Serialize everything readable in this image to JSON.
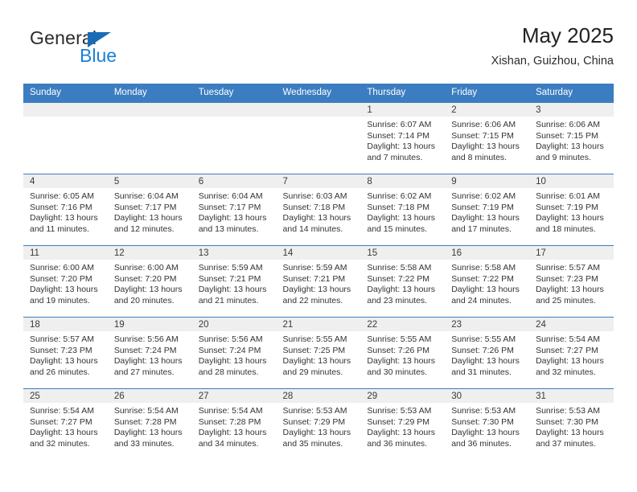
{
  "brand": {
    "name_top": "General",
    "name_bottom": "Blue",
    "triangle_color": "#1a6cb5",
    "blue_color": "#1a7fd4"
  },
  "header": {
    "title": "May 2025",
    "subtitle": "Xishan, Guizhou, China"
  },
  "theme": {
    "header_bg": "#3b7dc0",
    "date_band_bg": "#efefef",
    "row_rule": "#3b7dc0"
  },
  "weekday_headers": [
    "Sunday",
    "Monday",
    "Tuesday",
    "Wednesday",
    "Thursday",
    "Friday",
    "Saturday"
  ],
  "weeks": [
    [
      {
        "day": "",
        "empty": true,
        "sunrise": "",
        "sunset": "",
        "daylight_1": "",
        "daylight_2": ""
      },
      {
        "day": "",
        "empty": true,
        "sunrise": "",
        "sunset": "",
        "daylight_1": "",
        "daylight_2": ""
      },
      {
        "day": "",
        "empty": true,
        "sunrise": "",
        "sunset": "",
        "daylight_1": "",
        "daylight_2": ""
      },
      {
        "day": "",
        "empty": true,
        "sunrise": "",
        "sunset": "",
        "daylight_1": "",
        "daylight_2": ""
      },
      {
        "day": "1",
        "empty": false,
        "sunrise": "Sunrise: 6:07 AM",
        "sunset": "Sunset: 7:14 PM",
        "daylight_1": "Daylight: 13 hours",
        "daylight_2": "and 7 minutes."
      },
      {
        "day": "2",
        "empty": false,
        "sunrise": "Sunrise: 6:06 AM",
        "sunset": "Sunset: 7:15 PM",
        "daylight_1": "Daylight: 13 hours",
        "daylight_2": "and 8 minutes."
      },
      {
        "day": "3",
        "empty": false,
        "sunrise": "Sunrise: 6:06 AM",
        "sunset": "Sunset: 7:15 PM",
        "daylight_1": "Daylight: 13 hours",
        "daylight_2": "and 9 minutes."
      }
    ],
    [
      {
        "day": "4",
        "empty": false,
        "sunrise": "Sunrise: 6:05 AM",
        "sunset": "Sunset: 7:16 PM",
        "daylight_1": "Daylight: 13 hours",
        "daylight_2": "and 11 minutes."
      },
      {
        "day": "5",
        "empty": false,
        "sunrise": "Sunrise: 6:04 AM",
        "sunset": "Sunset: 7:17 PM",
        "daylight_1": "Daylight: 13 hours",
        "daylight_2": "and 12 minutes."
      },
      {
        "day": "6",
        "empty": false,
        "sunrise": "Sunrise: 6:04 AM",
        "sunset": "Sunset: 7:17 PM",
        "daylight_1": "Daylight: 13 hours",
        "daylight_2": "and 13 minutes."
      },
      {
        "day": "7",
        "empty": false,
        "sunrise": "Sunrise: 6:03 AM",
        "sunset": "Sunset: 7:18 PM",
        "daylight_1": "Daylight: 13 hours",
        "daylight_2": "and 14 minutes."
      },
      {
        "day": "8",
        "empty": false,
        "sunrise": "Sunrise: 6:02 AM",
        "sunset": "Sunset: 7:18 PM",
        "daylight_1": "Daylight: 13 hours",
        "daylight_2": "and 15 minutes."
      },
      {
        "day": "9",
        "empty": false,
        "sunrise": "Sunrise: 6:02 AM",
        "sunset": "Sunset: 7:19 PM",
        "daylight_1": "Daylight: 13 hours",
        "daylight_2": "and 17 minutes."
      },
      {
        "day": "10",
        "empty": false,
        "sunrise": "Sunrise: 6:01 AM",
        "sunset": "Sunset: 7:19 PM",
        "daylight_1": "Daylight: 13 hours",
        "daylight_2": "and 18 minutes."
      }
    ],
    [
      {
        "day": "11",
        "empty": false,
        "sunrise": "Sunrise: 6:00 AM",
        "sunset": "Sunset: 7:20 PM",
        "daylight_1": "Daylight: 13 hours",
        "daylight_2": "and 19 minutes."
      },
      {
        "day": "12",
        "empty": false,
        "sunrise": "Sunrise: 6:00 AM",
        "sunset": "Sunset: 7:20 PM",
        "daylight_1": "Daylight: 13 hours",
        "daylight_2": "and 20 minutes."
      },
      {
        "day": "13",
        "empty": false,
        "sunrise": "Sunrise: 5:59 AM",
        "sunset": "Sunset: 7:21 PM",
        "daylight_1": "Daylight: 13 hours",
        "daylight_2": "and 21 minutes."
      },
      {
        "day": "14",
        "empty": false,
        "sunrise": "Sunrise: 5:59 AM",
        "sunset": "Sunset: 7:21 PM",
        "daylight_1": "Daylight: 13 hours",
        "daylight_2": "and 22 minutes."
      },
      {
        "day": "15",
        "empty": false,
        "sunrise": "Sunrise: 5:58 AM",
        "sunset": "Sunset: 7:22 PM",
        "daylight_1": "Daylight: 13 hours",
        "daylight_2": "and 23 minutes."
      },
      {
        "day": "16",
        "empty": false,
        "sunrise": "Sunrise: 5:58 AM",
        "sunset": "Sunset: 7:22 PM",
        "daylight_1": "Daylight: 13 hours",
        "daylight_2": "and 24 minutes."
      },
      {
        "day": "17",
        "empty": false,
        "sunrise": "Sunrise: 5:57 AM",
        "sunset": "Sunset: 7:23 PM",
        "daylight_1": "Daylight: 13 hours",
        "daylight_2": "and 25 minutes."
      }
    ],
    [
      {
        "day": "18",
        "empty": false,
        "sunrise": "Sunrise: 5:57 AM",
        "sunset": "Sunset: 7:23 PM",
        "daylight_1": "Daylight: 13 hours",
        "daylight_2": "and 26 minutes."
      },
      {
        "day": "19",
        "empty": false,
        "sunrise": "Sunrise: 5:56 AM",
        "sunset": "Sunset: 7:24 PM",
        "daylight_1": "Daylight: 13 hours",
        "daylight_2": "and 27 minutes."
      },
      {
        "day": "20",
        "empty": false,
        "sunrise": "Sunrise: 5:56 AM",
        "sunset": "Sunset: 7:24 PM",
        "daylight_1": "Daylight: 13 hours",
        "daylight_2": "and 28 minutes."
      },
      {
        "day": "21",
        "empty": false,
        "sunrise": "Sunrise: 5:55 AM",
        "sunset": "Sunset: 7:25 PM",
        "daylight_1": "Daylight: 13 hours",
        "daylight_2": "and 29 minutes."
      },
      {
        "day": "22",
        "empty": false,
        "sunrise": "Sunrise: 5:55 AM",
        "sunset": "Sunset: 7:26 PM",
        "daylight_1": "Daylight: 13 hours",
        "daylight_2": "and 30 minutes."
      },
      {
        "day": "23",
        "empty": false,
        "sunrise": "Sunrise: 5:55 AM",
        "sunset": "Sunset: 7:26 PM",
        "daylight_1": "Daylight: 13 hours",
        "daylight_2": "and 31 minutes."
      },
      {
        "day": "24",
        "empty": false,
        "sunrise": "Sunrise: 5:54 AM",
        "sunset": "Sunset: 7:27 PM",
        "daylight_1": "Daylight: 13 hours",
        "daylight_2": "and 32 minutes."
      }
    ],
    [
      {
        "day": "25",
        "empty": false,
        "sunrise": "Sunrise: 5:54 AM",
        "sunset": "Sunset: 7:27 PM",
        "daylight_1": "Daylight: 13 hours",
        "daylight_2": "and 32 minutes."
      },
      {
        "day": "26",
        "empty": false,
        "sunrise": "Sunrise: 5:54 AM",
        "sunset": "Sunset: 7:28 PM",
        "daylight_1": "Daylight: 13 hours",
        "daylight_2": "and 33 minutes."
      },
      {
        "day": "27",
        "empty": false,
        "sunrise": "Sunrise: 5:54 AM",
        "sunset": "Sunset: 7:28 PM",
        "daylight_1": "Daylight: 13 hours",
        "daylight_2": "and 34 minutes."
      },
      {
        "day": "28",
        "empty": false,
        "sunrise": "Sunrise: 5:53 AM",
        "sunset": "Sunset: 7:29 PM",
        "daylight_1": "Daylight: 13 hours",
        "daylight_2": "and 35 minutes."
      },
      {
        "day": "29",
        "empty": false,
        "sunrise": "Sunrise: 5:53 AM",
        "sunset": "Sunset: 7:29 PM",
        "daylight_1": "Daylight: 13 hours",
        "daylight_2": "and 36 minutes."
      },
      {
        "day": "30",
        "empty": false,
        "sunrise": "Sunrise: 5:53 AM",
        "sunset": "Sunset: 7:30 PM",
        "daylight_1": "Daylight: 13 hours",
        "daylight_2": "and 36 minutes."
      },
      {
        "day": "31",
        "empty": false,
        "sunrise": "Sunrise: 5:53 AM",
        "sunset": "Sunset: 7:30 PM",
        "daylight_1": "Daylight: 13 hours",
        "daylight_2": "and 37 minutes."
      }
    ]
  ]
}
